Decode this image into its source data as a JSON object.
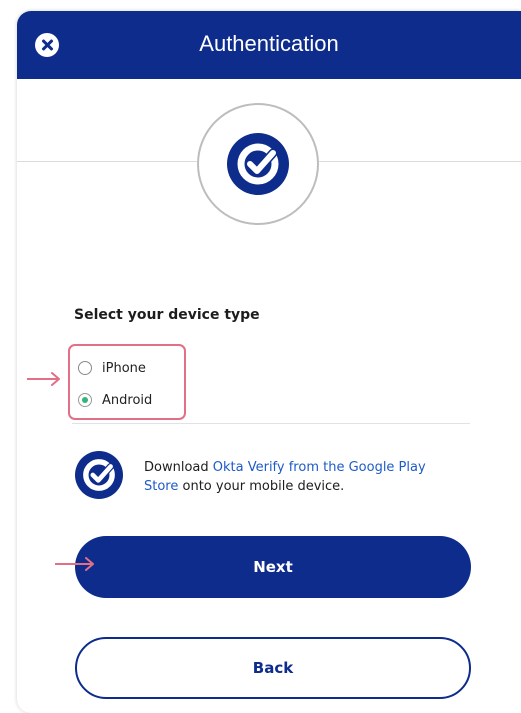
{
  "header": {
    "title": "Authentication"
  },
  "form": {
    "section_label": "Select your device type",
    "options": [
      {
        "label": "iPhone",
        "selected": false
      },
      {
        "label": "Android",
        "selected": true
      }
    ]
  },
  "info": {
    "prefix": "Download ",
    "link": "Okta Verify from the Google Play Store",
    "suffix": " onto your mobile device."
  },
  "buttons": {
    "next": "Next",
    "back": "Back"
  },
  "colors": {
    "brand": "#0d2c8c",
    "highlight": "#e16f86",
    "radio_selected": "#2fb67a",
    "link": "#1d5bc9"
  },
  "icons": [
    "close-icon",
    "okta-verify-icon",
    "arrow-right-icon"
  ]
}
